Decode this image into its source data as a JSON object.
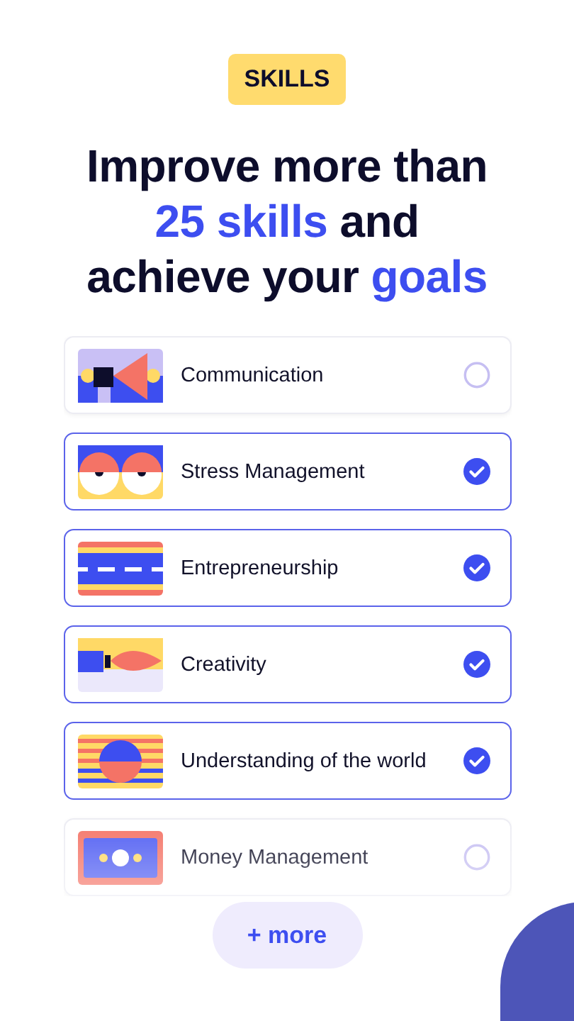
{
  "badge": "SKILLS",
  "headline": [
    {
      "text": "Improve more than ",
      "accent": false
    },
    {
      "text": "25 skills",
      "accent": true
    },
    {
      "text": " and achieve your ",
      "accent": false
    },
    {
      "text": "goals",
      "accent": true
    }
  ],
  "skills": [
    {
      "label": "Communication",
      "kind": "megaphone",
      "selected": false
    },
    {
      "label": "Stress Management",
      "kind": "eyes",
      "selected": true
    },
    {
      "label": "Entrepreneurship",
      "kind": "road",
      "selected": true
    },
    {
      "label": "Creativity",
      "kind": "brush",
      "selected": true
    },
    {
      "label": "Understanding of the world",
      "kind": "globe",
      "selected": true
    },
    {
      "label": "Money Management",
      "kind": "banknote",
      "selected": false
    }
  ],
  "more_button": "+ more"
}
